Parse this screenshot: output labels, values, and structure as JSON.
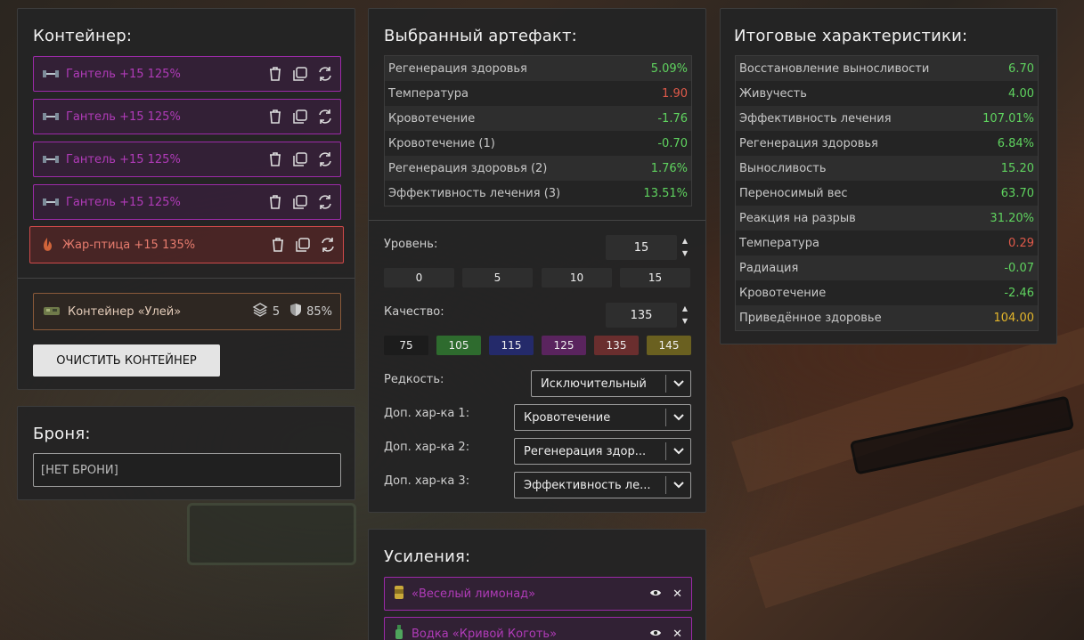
{
  "container": {
    "title": "Контейнер:",
    "items": [
      {
        "label": "Гантель +15 125%",
        "icon": "dumbbell-icon"
      },
      {
        "label": "Гантель +15 125%",
        "icon": "dumbbell-icon"
      },
      {
        "label": "Гантель +15 125%",
        "icon": "dumbbell-icon"
      },
      {
        "label": "Гантель +15 125%",
        "icon": "dumbbell-icon"
      },
      {
        "label": "Жар-птица +15 135%",
        "icon": "firebird-icon"
      }
    ],
    "hive": {
      "label": "Контейнер «Улей»",
      "slots": "5",
      "protection": "85%"
    },
    "clear_label": "ОЧИСТИТЬ КОНТЕЙНЕР"
  },
  "armor": {
    "title": "Броня:",
    "value": "[НЕТ БРОНИ]"
  },
  "artifact": {
    "title": "Выбранный артефакт:",
    "stats": [
      {
        "name": "Регенерация здоровья",
        "value": "5.09%",
        "color": "#5fd35f"
      },
      {
        "name": "Температура",
        "value": "1.90",
        "color": "#e05a4a"
      },
      {
        "name": "Кровотечение",
        "value": "-1.76",
        "color": "#5fd35f"
      },
      {
        "name": "Кровотечение (1)",
        "value": "-0.70",
        "color": "#5fd35f"
      },
      {
        "name": "Регенерация здоровья (2)",
        "value": "1.76%",
        "color": "#5fd35f"
      },
      {
        "name": "Эффективность лечения (3)",
        "value": "13.51%",
        "color": "#5fd35f"
      }
    ],
    "level_label": "Уровень:",
    "level_value": "15",
    "level_presets": [
      "0",
      "5",
      "10",
      "15"
    ],
    "quality_label": "Качество:",
    "quality_value": "135",
    "quality_presets": [
      {
        "label": "75",
        "color": "#1c1c1c"
      },
      {
        "label": "105",
        "color": "#2e6b2e"
      },
      {
        "label": "115",
        "color": "#242a6a"
      },
      {
        "label": "125",
        "color": "#5a245e"
      },
      {
        "label": "135",
        "color": "#6a2e2e"
      },
      {
        "label": "145",
        "color": "#6a6020"
      }
    ],
    "rarity_label": "Редкость:",
    "rarity_value": "Исключительный",
    "extra1_label": "Доп. хар-ка 1:",
    "extra1_value": "Кровотечение",
    "extra2_label": "Доп. хар-ка 2:",
    "extra2_value": "Регенерация здор...",
    "extra3_label": "Доп. хар-ка 3:",
    "extra3_value": "Эффективность ле..."
  },
  "boosts": {
    "title": "Усиления:",
    "items": [
      {
        "label": "«Веселый лимонад»",
        "icon": "lemonade-can-icon"
      },
      {
        "label": "Водка «Кривой Коготь»",
        "icon": "bottle-icon"
      }
    ]
  },
  "totals": {
    "title": "Итоговые характеристики:",
    "stats": [
      {
        "name": "Восстановление выносливости",
        "value": "6.70",
        "color": "#5fd35f"
      },
      {
        "name": "Живучесть",
        "value": "4.00",
        "color": "#5fd35f"
      },
      {
        "name": "Эффективность лечения",
        "value": "107.01%",
        "color": "#5fd35f"
      },
      {
        "name": "Регенерация здоровья",
        "value": "6.84%",
        "color": "#5fd35f"
      },
      {
        "name": "Выносливость",
        "value": "15.20",
        "color": "#5fd35f"
      },
      {
        "name": "Переносимый вес",
        "value": "63.70",
        "color": "#5fd35f"
      },
      {
        "name": "Реакция на разрыв",
        "value": "31.20%",
        "color": "#5fd35f"
      },
      {
        "name": "Температура",
        "value": "0.29",
        "color": "#e05a4a"
      },
      {
        "name": "Радиация",
        "value": "-0.07",
        "color": "#5fd35f"
      },
      {
        "name": "Кровотечение",
        "value": "-2.46",
        "color": "#5fd35f"
      },
      {
        "name": "Приведённое здоровье",
        "value": "104.00",
        "color": "#e3b52b"
      }
    ]
  }
}
